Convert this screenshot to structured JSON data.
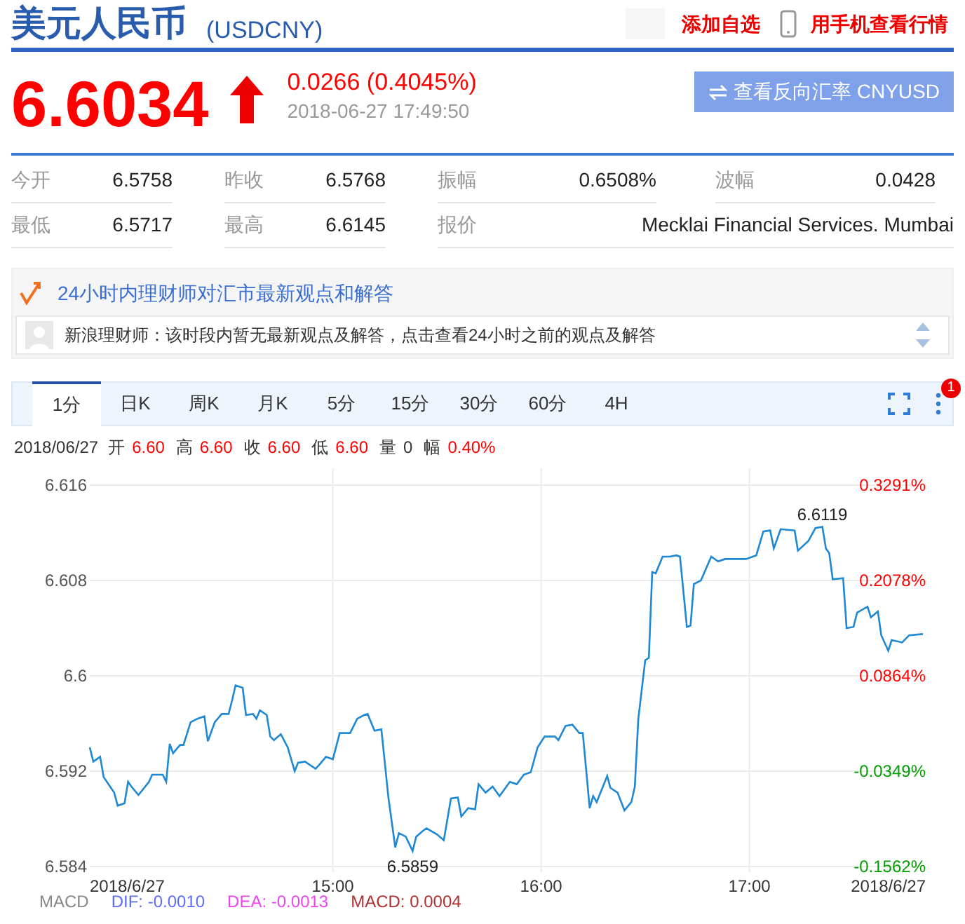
{
  "header": {
    "title": "美元人民币",
    "code": "(USDCNY)",
    "actions": [
      {
        "label": "添加自选",
        "kind": "blank"
      },
      {
        "label": "用手机查看行情",
        "kind": "phone"
      }
    ]
  },
  "quote": {
    "price": "6.6034",
    "rising": true,
    "change": "0.0266 (0.4045%)",
    "time": "2018-06-27 17:49:50",
    "reverse_button": "查看反向汇率 CNYUSD"
  },
  "stats": [
    [
      {
        "label": "今开",
        "value": "6.5758"
      },
      {
        "label": "昨收",
        "value": "6.5768"
      },
      {
        "label": "振幅",
        "value": "0.6508%"
      },
      {
        "label": "波幅",
        "value": "0.0428"
      }
    ],
    [
      {
        "label": "最低",
        "value": "6.5717"
      },
      {
        "label": "最高",
        "value": "6.6145"
      },
      {
        "label": "报价",
        "value": "Mecklai Financial Services. Mumbai"
      }
    ]
  ],
  "advisor": {
    "title": "24小时内理财师对汇市最新观点和解答",
    "message": "新浪理财师：该时段内暂无最新观点及解答，点击查看24小时之前的观点及解答"
  },
  "chart_tabs": [
    {
      "label": "1分",
      "selected": true
    },
    {
      "label": "日K",
      "selected": false
    },
    {
      "label": "周K",
      "selected": false
    },
    {
      "label": "月K",
      "selected": false
    },
    {
      "label": "5分",
      "selected": false
    },
    {
      "label": "15分",
      "selected": false
    },
    {
      "label": "30分",
      "selected": false
    },
    {
      "label": "60分",
      "selected": false
    },
    {
      "label": "4H",
      "selected": false
    }
  ],
  "menu_badge": "1",
  "ohlc": {
    "date": "2018/06/27",
    "fields": [
      {
        "label": "开",
        "value": "6.60",
        "color": "#ff0000"
      },
      {
        "label": "高",
        "value": "6.60",
        "color": "#ff0000"
      },
      {
        "label": "收",
        "value": "6.60",
        "color": "#ff0000"
      },
      {
        "label": "低",
        "value": "6.60",
        "color": "#ff0000"
      },
      {
        "label": "量",
        "value": "0",
        "color": "#333333"
      },
      {
        "label": "幅",
        "value": "0.40%",
        "color": "#ff0000"
      }
    ]
  },
  "chart": {
    "chart_data": {
      "type": "line",
      "x": [
        13.833,
        13.85,
        13.883,
        13.9,
        13.95,
        13.967,
        14,
        14.017,
        14.033,
        14.067,
        14.117,
        14.133,
        14.183,
        14.2,
        14.217,
        14.233,
        14.267,
        14.283,
        14.317,
        14.35,
        14.383,
        14.4,
        14.433,
        14.467,
        14.5,
        14.517,
        14.533,
        14.567,
        14.583,
        14.617,
        14.633,
        14.65,
        14.683,
        14.7,
        14.717,
        14.75,
        14.783,
        14.817,
        14.833,
        14.867,
        14.917,
        14.933,
        14.967,
        15,
        15.033,
        15.05,
        15.083,
        15.117,
        15.15,
        15.167,
        15.2,
        15.233,
        15.267,
        15.3,
        15.317,
        15.35,
        15.383,
        15.4,
        15.433,
        15.45,
        15.5,
        15.533,
        15.567,
        15.6,
        15.617,
        15.65,
        15.683,
        15.7,
        15.733,
        15.767,
        15.8,
        15.817,
        15.85,
        15.883,
        15.917,
        15.95,
        15.983,
        16.017,
        16.067,
        16.083,
        16.117,
        16.15,
        16.183,
        16.2,
        16.233,
        16.25,
        16.267,
        16.317,
        16.333,
        16.367,
        16.4,
        16.433,
        16.45,
        16.467,
        16.5,
        16.517,
        16.533,
        16.55,
        16.583,
        16.617,
        16.65,
        16.667,
        16.7,
        16.717,
        16.733,
        16.767,
        16.817,
        16.85,
        16.883,
        16.983,
        17.033,
        17.067,
        17.1,
        17.117,
        17.15,
        17.217,
        17.233,
        17.283,
        17.317,
        17.35,
        17.367,
        17.383,
        17.4,
        17.45,
        17.467,
        17.5,
        17.517,
        17.567,
        17.583,
        17.617,
        17.633,
        17.667,
        17.683,
        17.733,
        17.767,
        17.833
      ],
      "series": [
        {
          "color": "#1e88d4",
          "values": [
            6.594,
            6.5928,
            6.5932,
            6.5915,
            6.5902,
            6.5891,
            6.5893,
            6.5911,
            6.5907,
            6.59,
            6.5911,
            6.5917,
            6.5917,
            6.5911,
            6.5943,
            6.5935,
            6.5942,
            6.5942,
            6.5961,
            6.5964,
            6.5966,
            6.5945,
            6.5961,
            6.5968,
            6.5968,
            6.598,
            6.5992,
            6.599,
            6.5967,
            6.5968,
            6.5964,
            6.5971,
            6.5967,
            6.5949,
            6.5946,
            6.5951,
            6.594,
            6.592,
            6.5927,
            6.5928,
            6.5922,
            6.5925,
            6.5932,
            6.593,
            6.5952,
            6.5952,
            6.5952,
            6.5964,
            6.5967,
            6.5968,
            6.5954,
            6.5955,
            6.5898,
            6.5856,
            6.5868,
            6.5865,
            6.5853,
            6.5865,
            6.587,
            6.5872,
            6.5867,
            6.5862,
            6.5897,
            6.5898,
            6.5882,
            6.5889,
            6.5888,
            6.5909,
            6.5902,
            6.5907,
            6.5899,
            6.5903,
            6.5911,
            6.5909,
            6.5917,
            6.5919,
            6.594,
            6.5949,
            6.5949,
            6.5946,
            6.5958,
            6.5959,
            6.5952,
            6.5952,
            6.5889,
            6.5899,
            6.5894,
            6.5916,
            6.5906,
            6.5902,
            6.5887,
            6.5894,
            6.5907,
            6.5964,
            6.6013,
            6.6015,
            6.6087,
            6.6086,
            6.61,
            6.61,
            6.6101,
            6.61,
            6.6041,
            6.6042,
            6.6077,
            6.608,
            6.61,
            6.6096,
            6.6098,
            6.6098,
            6.6101,
            6.6121,
            6.6122,
            6.6107,
            6.6123,
            6.6122,
            6.6105,
            6.6113,
            6.6124,
            6.6125,
            6.6107,
            6.6103,
            6.6081,
            6.6082,
            6.604,
            6.6041,
            6.6053,
            6.6058,
            6.6049,
            6.6054,
            6.6034,
            6.6021,
            6.603,
            6.6028,
            6.6034,
            6.6035
          ]
        }
      ],
      "xlim": [
        13.833,
        17.833
      ],
      "ylim": [
        6.584,
        6.616
      ],
      "grid": true,
      "xticks": [
        {
          "value": 13.833,
          "label": "2018/6/27"
        },
        {
          "value": 15,
          "label": "15:00"
        },
        {
          "value": 16,
          "label": "16:00"
        },
        {
          "value": 17,
          "label": "17:00"
        },
        {
          "value": 17.833,
          "label": "2018/6/27"
        }
      ],
      "yticks": [
        {
          "value": 6.616,
          "label": "6.616"
        },
        {
          "value": 6.608,
          "label": "6.608"
        },
        {
          "value": 6.6,
          "label": "6.6"
        },
        {
          "value": 6.592,
          "label": "6.592"
        },
        {
          "value": 6.584,
          "label": "6.584"
        }
      ],
      "annotations": [
        "6.6119",
        "6.5859"
      ]
    },
    "right_labels": [
      {
        "text": "0.3291%",
        "color": "#ff0000"
      },
      {
        "text": "0.2078%",
        "color": "#ff0000"
      },
      {
        "text": "0.0864%",
        "color": "#ff0000"
      },
      {
        "text": "-0.0349%",
        "color": "#00a000"
      },
      {
        "text": "-0.1562%",
        "color": "#00a000"
      }
    ],
    "macd": [
      {
        "text": "MACD",
        "color": "#888888"
      },
      {
        "text": "DIF: -0.0010",
        "color": "#5b6cff"
      },
      {
        "text": "DEA: -0.0013",
        "color": "#ee44ee"
      },
      {
        "text": "MACD: 0.0004",
        "color": "#b03030"
      }
    ]
  }
}
